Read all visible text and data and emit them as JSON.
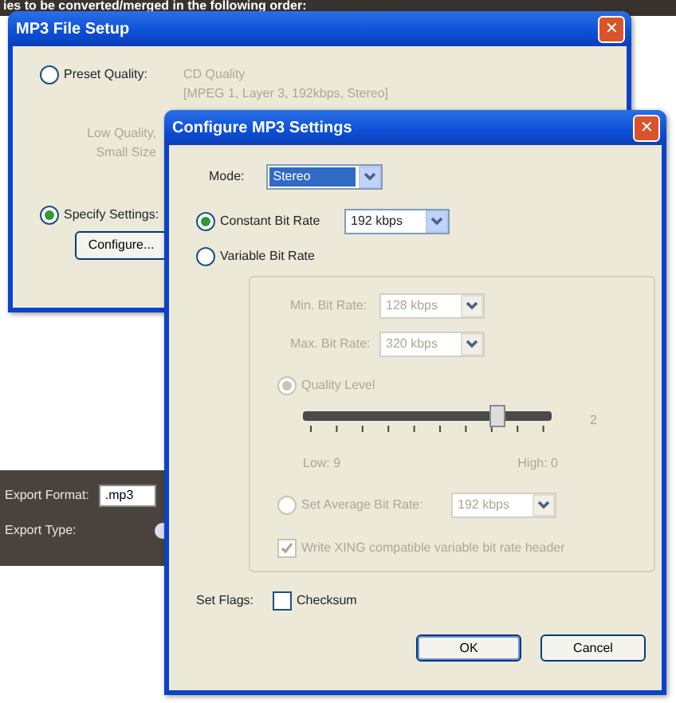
{
  "background": {
    "heading": "ies to be converted/merged in the following order:",
    "export_format": {
      "label": "Export Format:",
      "value": ".mp3"
    },
    "export_type": {
      "label": "Export Type:"
    }
  },
  "file_setup": {
    "title": "MP3 File Setup",
    "close": "✕",
    "options": [
      {
        "label": "Preset Quality:",
        "selected": false
      },
      {
        "label": "Specify Settings:",
        "selected": true
      }
    ],
    "preset_lines": [
      "CD Quality",
      "[MPEG 1, Layer 3, 192kbps, Stereo]"
    ],
    "low_quality_lines": [
      "Low Quality,",
      "Small Size"
    ],
    "configure_button": "Configure..."
  },
  "configure": {
    "title": "Configure MP3 Settings",
    "close": "✕",
    "mode": {
      "label": "Mode:",
      "value": "Stereo"
    },
    "rate_options": [
      {
        "label": "Constant Bit Rate",
        "selected": true,
        "value": "192 kbps"
      },
      {
        "label": "Variable Bit Rate",
        "selected": false
      }
    ],
    "vbr": {
      "disabled": true,
      "min": {
        "label": "Min. Bit Rate:",
        "value": "128 kbps"
      },
      "max": {
        "label": "Max. Bit Rate:",
        "value": "320 kbps"
      },
      "modes": [
        {
          "label": "Quality Level",
          "selected": true
        },
        {
          "label": "Set Average Bit Rate:",
          "selected": false,
          "value": "192 kbps"
        }
      ],
      "quality": {
        "level": 0.78,
        "reading": "2",
        "low": "Low: 9",
        "high": "High: 0"
      },
      "xing": {
        "label": "Write XING compatible variable bit rate header",
        "checked": true
      }
    },
    "flags": {
      "label": "Set Flags:",
      "checksum": {
        "label": "Checksum",
        "checked": false
      }
    },
    "buttons": [
      "OK",
      "Cancel"
    ]
  }
}
